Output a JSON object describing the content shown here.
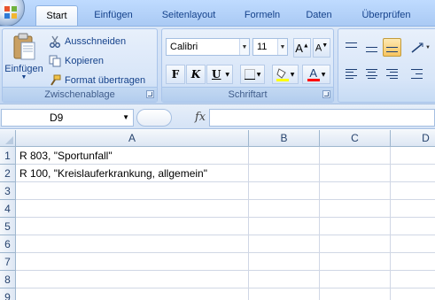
{
  "tabs": [
    {
      "label": "Start",
      "active": true
    },
    {
      "label": "Einfügen",
      "active": false
    },
    {
      "label": "Seitenlayout",
      "active": false
    },
    {
      "label": "Formeln",
      "active": false
    },
    {
      "label": "Daten",
      "active": false
    },
    {
      "label": "Überprüfen",
      "active": false
    }
  ],
  "ribbon": {
    "clipboard": {
      "paste_label": "Einfügen",
      "cut_label": "Ausschneiden",
      "copy_label": "Kopieren",
      "format_painter_label": "Format übertragen",
      "group_label": "Zwischenablage"
    },
    "font": {
      "font_name": "Calibri",
      "font_size": "11",
      "bold_label": "F",
      "italic_label": "K",
      "underline_label": "U",
      "group_label": "Schriftart",
      "fill_color": "#ffff00",
      "font_color": "#ff0000"
    }
  },
  "formula_bar": {
    "name_box": "D9",
    "fx_label": "fx",
    "formula": ""
  },
  "grid": {
    "columns": [
      "A",
      "B",
      "C",
      "D"
    ],
    "rows": [
      "1",
      "2",
      "3",
      "4",
      "5",
      "6",
      "7",
      "8",
      "9"
    ],
    "cells": {
      "A1": "R 803, \"Sportunfall\"",
      "A2": "R 100, \"Kreislauferkrankung, allgemein\""
    }
  }
}
